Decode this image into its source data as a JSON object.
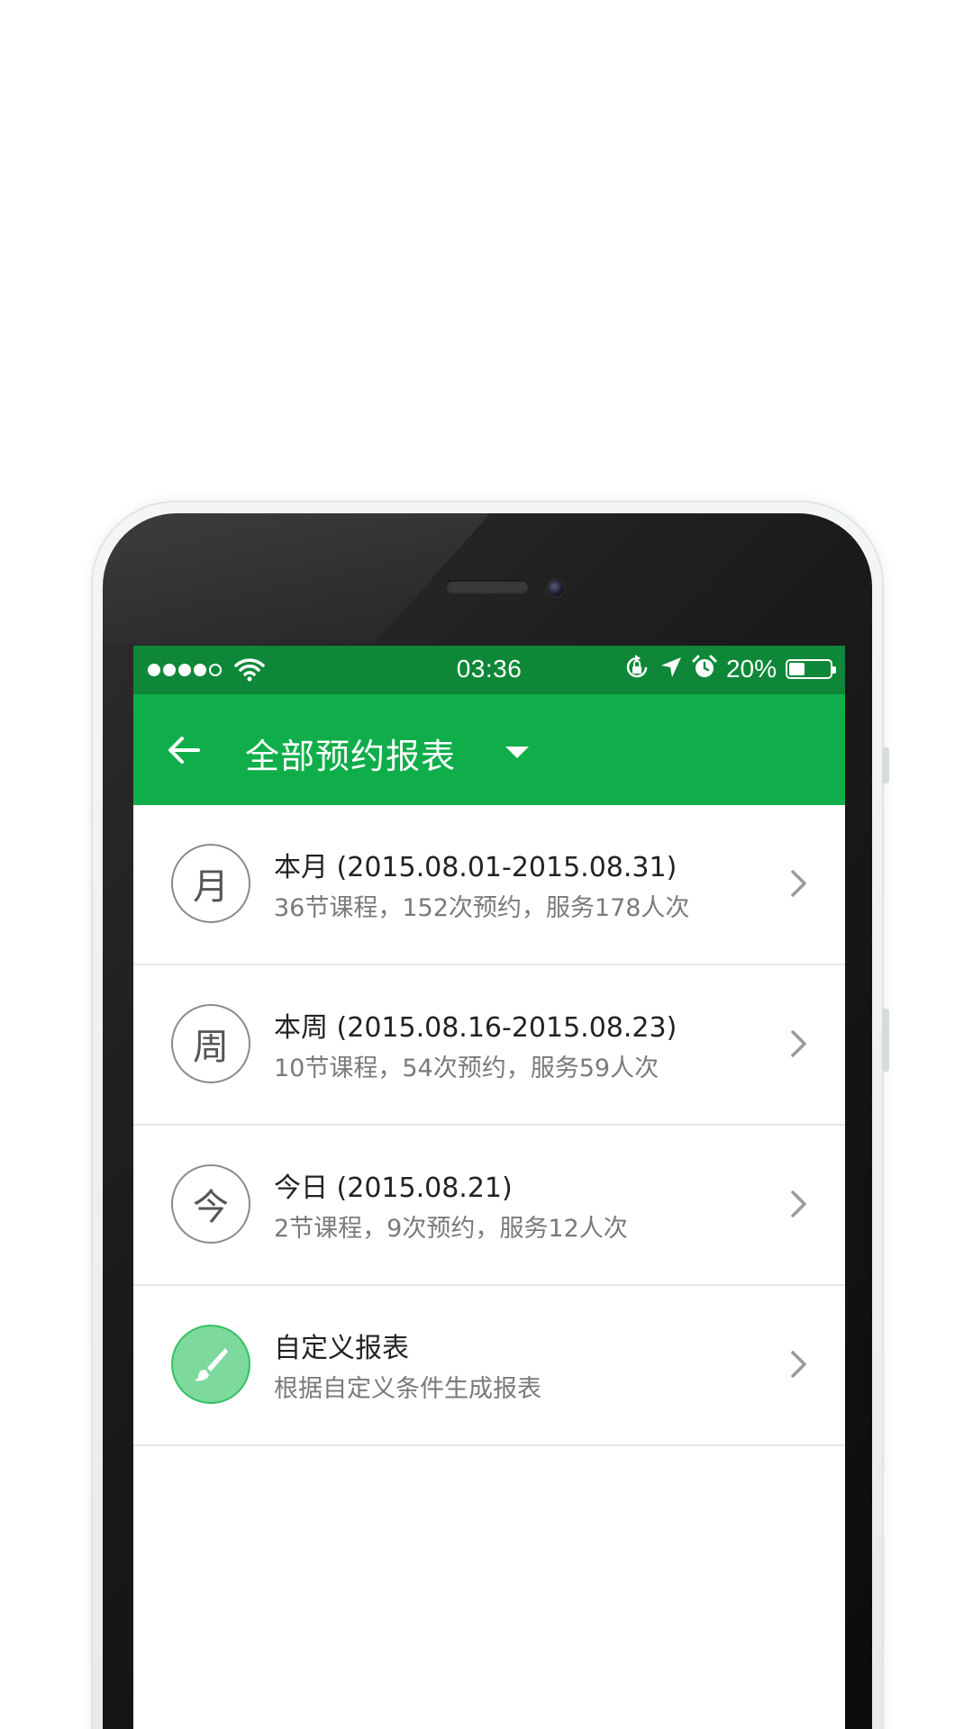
{
  "status_bar": {
    "time": "03:36",
    "battery_percent": "20%",
    "battery_level": 0.2,
    "signal_bars": 4,
    "signal_total": 5
  },
  "app_bar": {
    "title": "全部预约报表",
    "back_icon": "arrow-left-icon",
    "dropdown_icon": "caret-down-icon"
  },
  "reports": [
    {
      "icon_char": "月",
      "title": "本月 (2015.08.01-2015.08.31)",
      "subtitle": "36节课程，152次预约，服务178人次"
    },
    {
      "icon_char": "周",
      "title": "本周 (2015.08.16-2015.08.23)",
      "subtitle": "10节课程，54次预约，服务59人次"
    },
    {
      "icon_char": "今",
      "title": "今日 (2015.08.21)",
      "subtitle": "2节课程，9次预约，服务12人次"
    },
    {
      "icon": "brush-icon",
      "title": "自定义报表",
      "subtitle": "根据自定义条件生成报表"
    }
  ],
  "colors": {
    "status_bar": "#0e8838",
    "app_bar": "#10ae4b",
    "custom_icon_fill": "#7dd99d"
  }
}
